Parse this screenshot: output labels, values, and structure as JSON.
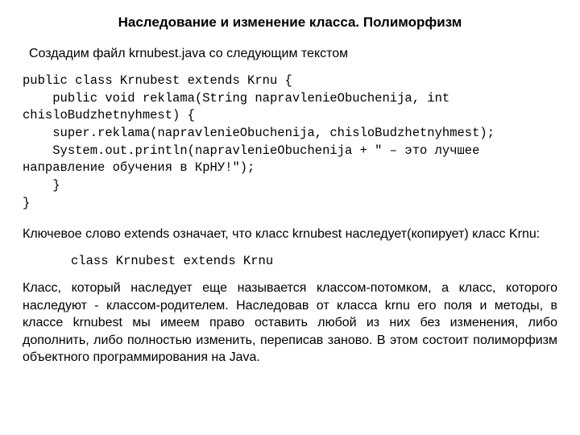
{
  "title": "Наследование и изменение класса. Полиморфизм",
  "intro": "Создадим файл krnubest.java со следующим текстом",
  "code": "public class Krnubest extends Krnu {\n    public void reklama(String napravlenieObuchenija, int chisloBudzhetnyhmest) {\n    super.reklama(napravlenieObuchenija, chisloBudzhetnyhmest);\n    System.out.println(napravlenieObuchenija + \" – это лучшее направление обучения в КрНУ!\");\n    }\n}",
  "para1": "Ключевое слово extends означает, что класс krnubest наследует(копирует) класс Krnu:",
  "snippet": "class Krnubest extends Krnu",
  "para2": "Класс, который наследует еще называется классом-потомком, а класс, которого наследуют - классом-родителем. Наследовав от класса krnu его поля и методы, в классе krnubest мы имеем право оставить любой из них без изменения, либо дополнить, либо полностью изменить, переписав заново. В этом состоит полиморфизм объектного программирования на Java."
}
